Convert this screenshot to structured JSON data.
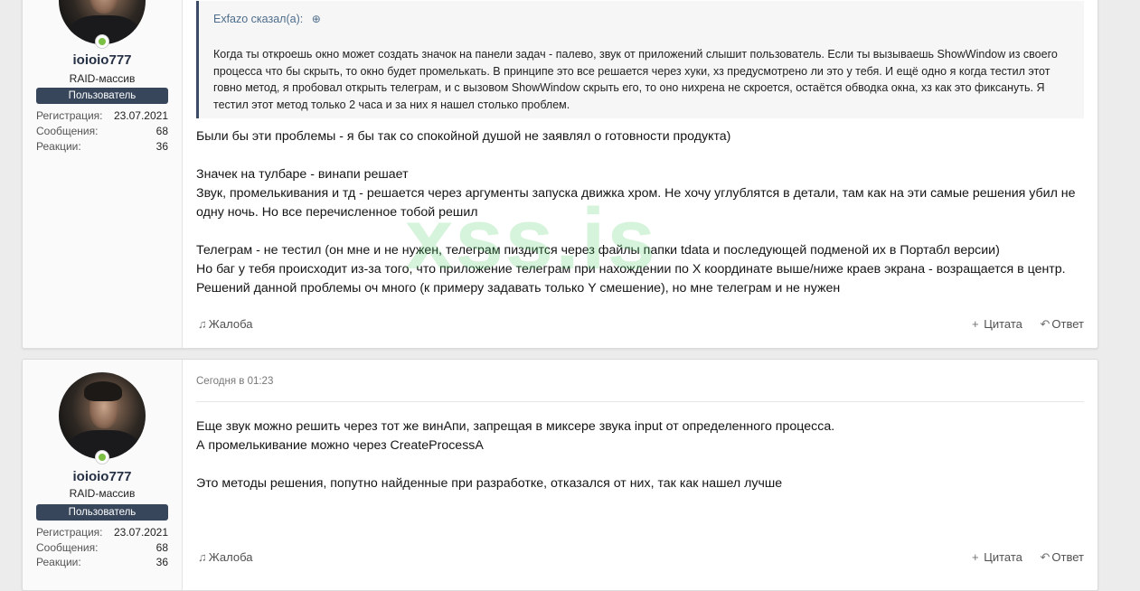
{
  "watermark": "xss.is",
  "posts": [
    {
      "user": {
        "name": "ioioio777",
        "title": "RAID-массив",
        "badge": "Пользователь",
        "stats": [
          {
            "label": "Регистрация:",
            "value": "23.07.2021"
          },
          {
            "label": "Сообщения:",
            "value": "68"
          },
          {
            "label": "Реакции:",
            "value": "36"
          }
        ]
      },
      "quote": {
        "author": "Exfazo сказал(а):",
        "text": "Когда ты откроешь окно может создать значок на панели задач - палево, звук от приложений слышит пользователь. Если ты вызываешь ShowWindow из своего процесса что бы скрыть, то окно будет промелькать. В принципе это все решается через хуки, хз предусмотрено ли это у тебя. И ещё одно я когда тестил этот говно метод, я пробовал открыть телеграм, и с вызовом ShowWindow скрыть его, то оно нихрена не скроется, остаётся обводка окна, хз как это фиксануть. Я тестил этот метод только 2 часа и за них я нашел столько проблем."
      },
      "paragraphs": [
        "Были бы эти проблемы - я бы так со спокойной душой не заявлял о готовности продукта)",
        "Значек на тулбаре - винапи решает",
        "Звук, промелькивания и тд - решается через аргументы запуска движка хром. Не хочу углублятся в детали, там как на эти самые решения убил не одну ночь. Но все перечисленное тобой решил",
        "Телеграм - не тестил (он мне и не нужен, телеграм пиздится через файлы папки tdata и последующей подменой их в Портабл версии)",
        "Но баг у тебя происходит из-за того, что приложение телеграм при нахождении по X координате выше/ниже краев экрана - возращается в центр. Решений данной проблемы оч много (к примеру задавать только Y смешение), но мне телеграм и не нужен"
      ],
      "actions": {
        "report": "Жалоба",
        "quote": "Цитата",
        "reply": "Ответ"
      }
    },
    {
      "user": {
        "name": "ioioio777",
        "title": "RAID-массив",
        "badge": "Пользователь",
        "stats": [
          {
            "label": "Регистрация:",
            "value": "23.07.2021"
          },
          {
            "label": "Сообщения:",
            "value": "68"
          },
          {
            "label": "Реакции:",
            "value": "36"
          }
        ]
      },
      "date": "Сегодня в 01:23",
      "paragraphs": [
        "Еще звук можно решить через тот же винАпи, запрещая в миксере звука input от определенного процесса.",
        "А промелькивание можно через CreateProcessA",
        "Это методы решения, попутно найденные при разработке, отказался от них, так как нашел лучше"
      ],
      "actions": {
        "report": "Жалоба",
        "quote": "Цитата",
        "reply": "Ответ"
      }
    }
  ]
}
